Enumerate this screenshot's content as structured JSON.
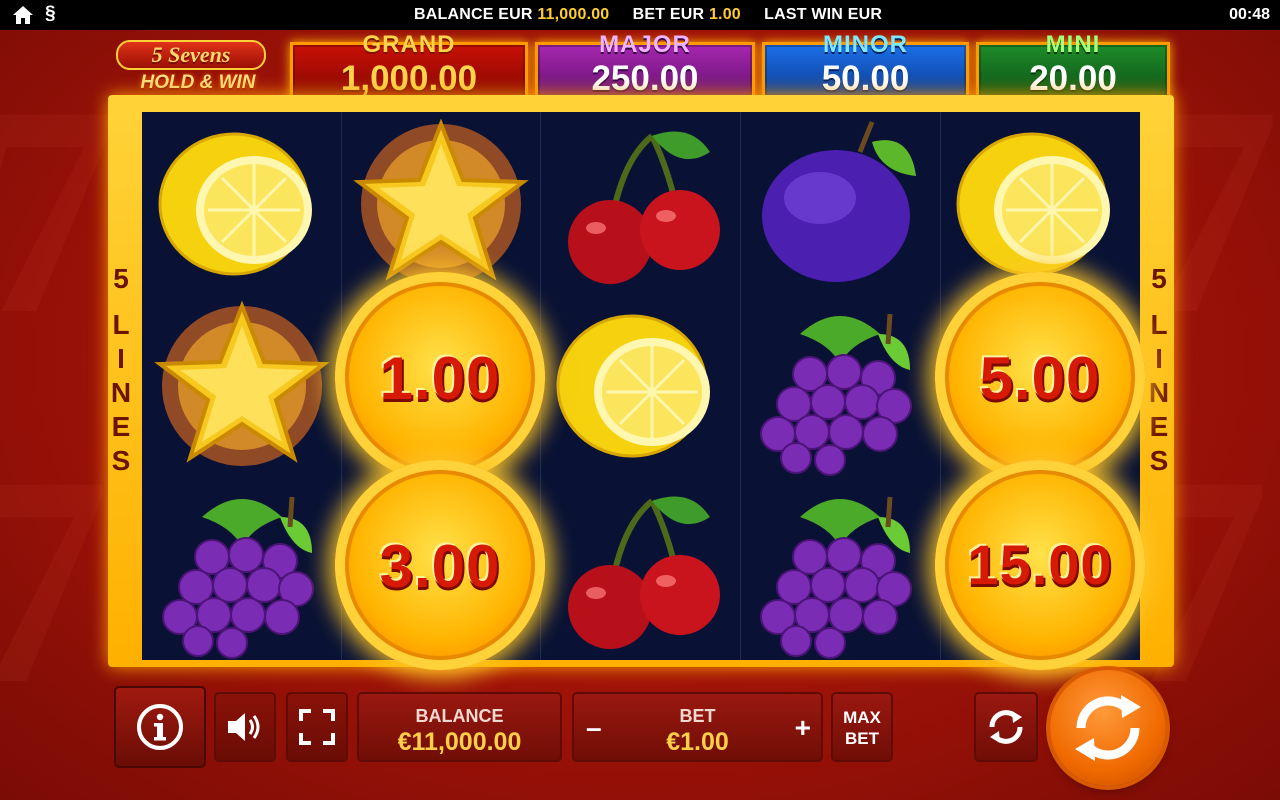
{
  "topbar": {
    "home_icon": "home-icon",
    "paragraph_icon": "§",
    "balance_label": "BALANCE EUR",
    "balance_value": "11,000.00",
    "bet_label": "BET EUR",
    "bet_value": "1.00",
    "last_win_label": "LAST WIN EUR",
    "clock": "00:48"
  },
  "logo": {
    "line1": "5 Sevens",
    "line2": "HOLD & WIN"
  },
  "jackpots": {
    "grand": {
      "label": "GRAND",
      "value": "1,000.00"
    },
    "major": {
      "label": "MAJOR",
      "value": "250.00"
    },
    "minor": {
      "label": "MINOR",
      "value": "50.00"
    },
    "mini": {
      "label": "MINI",
      "value": "20.00"
    }
  },
  "lines_indicator": {
    "count": "5",
    "word": "LINES"
  },
  "reels": [
    [
      "lemon",
      "star",
      "grapes"
    ],
    [
      "star",
      "coin",
      "coin"
    ],
    [
      "cherry",
      "lemon",
      "cherry"
    ],
    [
      "plum",
      "grapes",
      "grapes"
    ],
    [
      "lemon",
      "coin",
      "coin"
    ]
  ],
  "coins": {
    "r2c2": "1.00",
    "r3c2": "3.00",
    "r2c5": "5.00",
    "r3c5": "15.00"
  },
  "controls": {
    "balance_label": "BALANCE",
    "balance_value": "€11,000.00",
    "bet_label": "BET",
    "bet_value": "€1.00",
    "bet_minus": "–",
    "bet_plus": "+",
    "maxbet_line1": "MAX",
    "maxbet_line2": "BET"
  },
  "colors": {
    "accent_gold": "#ffcc33",
    "spin_orange": "#f06a00",
    "background_red": "#b3160b"
  }
}
